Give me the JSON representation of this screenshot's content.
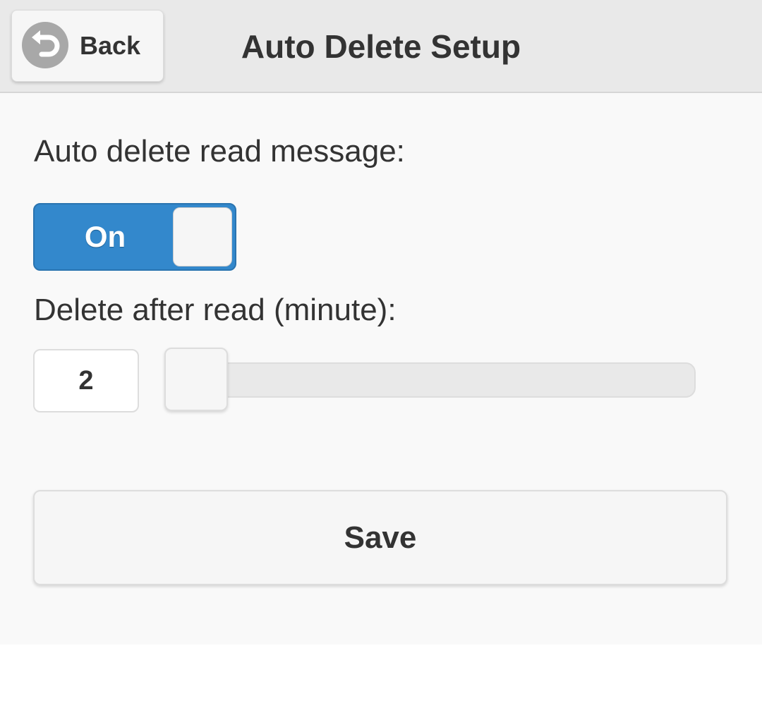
{
  "header": {
    "back_label": "Back",
    "back_icon": "undo-arrow-icon",
    "title": "Auto Delete Setup"
  },
  "auto_delete": {
    "label": "Auto delete read message:",
    "toggle_state": "On"
  },
  "delete_after": {
    "label": "Delete after read (minute):",
    "value": "2",
    "slider_fraction": 0.0
  },
  "save_label": "Save",
  "colors": {
    "accent": "#3388cc",
    "header_bg": "#e9e9e9",
    "page_bg": "#f9f9f9",
    "text": "#333333"
  }
}
